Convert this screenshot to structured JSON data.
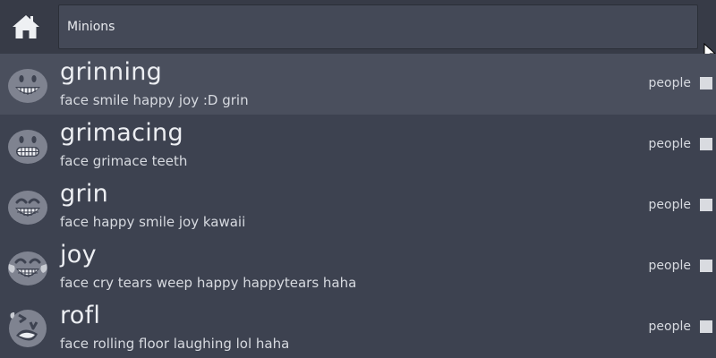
{
  "search": {
    "value": "Minions",
    "placeholder": ""
  },
  "icons": {
    "home": "home-icon",
    "cursor": "mouse-pointer-icon"
  },
  "colors": {
    "background": "#3d4250",
    "selected_row": "#4a4f5d",
    "emoji_fill": "#7f8390"
  },
  "results": [
    {
      "name": "grinning",
      "keywords": "face smile happy joy :D grin",
      "category": "people",
      "icon": "grinning-face-icon",
      "selected": true
    },
    {
      "name": "grimacing",
      "keywords": "face grimace teeth",
      "category": "people",
      "icon": "grimacing-face-icon",
      "selected": false
    },
    {
      "name": "grin",
      "keywords": "face happy smile joy kawaii",
      "category": "people",
      "icon": "grin-face-icon",
      "selected": false
    },
    {
      "name": "joy",
      "keywords": "face cry tears weep happy happytears haha",
      "category": "people",
      "icon": "joy-face-icon",
      "selected": false
    },
    {
      "name": "rofl",
      "keywords": "face rolling floor laughing lol haha",
      "category": "people",
      "icon": "rofl-face-icon",
      "selected": false
    }
  ]
}
